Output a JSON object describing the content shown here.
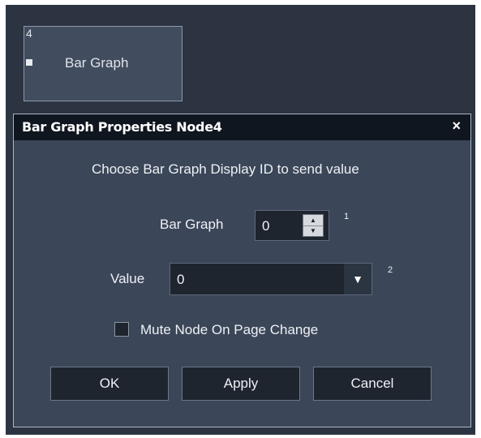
{
  "node": {
    "id": "4",
    "label": "Bar Graph"
  },
  "dialog": {
    "title": "Bar Graph Properties Node4",
    "close_label": "×",
    "description": "Choose Bar Graph Display ID to send value",
    "bar_graph": {
      "label": "Bar Graph",
      "value": "0",
      "superscript": "1"
    },
    "value_field": {
      "label": "Value",
      "value": "0",
      "superscript": "2"
    },
    "mute_checkbox": {
      "label": "Mute Node On Page Change",
      "checked": false
    },
    "buttons": {
      "ok": "OK",
      "apply": "Apply",
      "cancel": "Cancel"
    }
  },
  "icons": {
    "spin_up": "spin-up-arrow-icon",
    "spin_down": "spin-down-arrow-icon",
    "dropdown": "chevron-down-icon",
    "close": "close-icon"
  }
}
